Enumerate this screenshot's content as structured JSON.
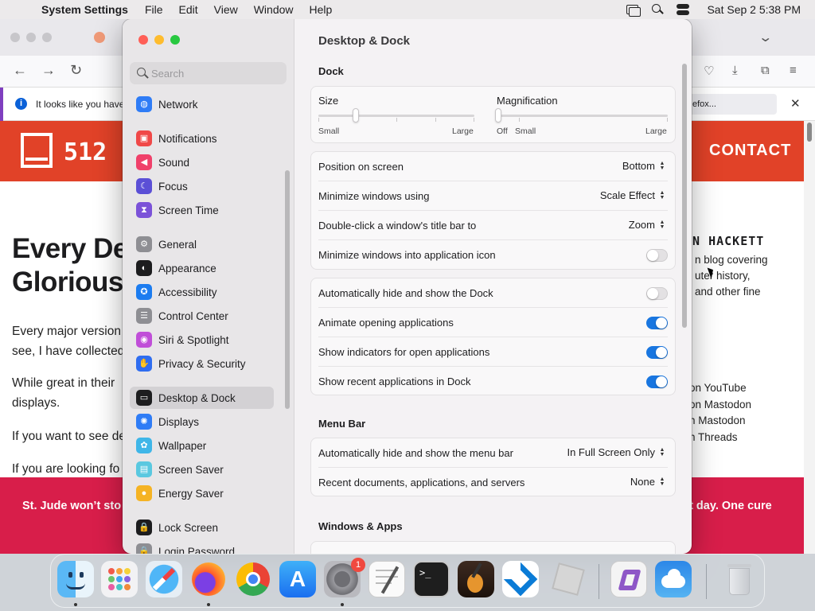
{
  "menubar": {
    "apple_icon": "",
    "app_name": "System Settings",
    "items": [
      "File",
      "Edit",
      "View",
      "Window",
      "Help"
    ],
    "clock": "Sat Sep 2  5:38 PM"
  },
  "browser": {
    "notice": "It looks like you haver",
    "notice_button": "efox...",
    "logo_text": "512",
    "nav_contact": "CONTACT",
    "nav_prev": "N",
    "title_line1": "Every De",
    "title_line2": "Glorious",
    "p1_line1": "Every major version",
    "p1_line2": "see, I have collected",
    "p2_line1": "While great in their",
    "p2_line2": "displays.",
    "p3": "If you want to see de",
    "p4": "If you are looking fo",
    "author": "EN HACKETT",
    "bio1": "n blog covering",
    "bio2": "uter history,",
    "bio3": "and other fine",
    "link1": "on YouTube",
    "link2": "on Mastodon",
    "link3": "n Mastodon",
    "link4": "n Threads",
    "banner_left": "St. Jude won’t sto",
    "banner_right": "at day. One cure"
  },
  "settings": {
    "search_placeholder": "Search",
    "sidebar": [
      {
        "label": "Network",
        "icon": "network-icon",
        "color": "#2f7cf6",
        "glyph": "◍"
      },
      {
        "label": "Notifications",
        "icon": "notifications-icon",
        "color": "#f04848",
        "glyph": "▣"
      },
      {
        "label": "Sound",
        "icon": "sound-icon",
        "color": "#f0406a",
        "glyph": "◀"
      },
      {
        "label": "Focus",
        "icon": "focus-icon",
        "color": "#5b4fd6",
        "glyph": "☾"
      },
      {
        "label": "Screen Time",
        "icon": "screen-time-icon",
        "color": "#7b52d8",
        "glyph": "⧗"
      },
      {
        "label": "General",
        "icon": "general-icon",
        "color": "#8e8e93",
        "glyph": "⚙"
      },
      {
        "label": "Appearance",
        "icon": "appearance-icon",
        "color": "#1d1d1f",
        "glyph": "◐"
      },
      {
        "label": "Accessibility",
        "icon": "accessibility-icon",
        "color": "#1c7cf0",
        "glyph": "✪"
      },
      {
        "label": "Control Center",
        "icon": "control-center-icon",
        "color": "#8e8e93",
        "glyph": "☰"
      },
      {
        "label": "Siri & Spotlight",
        "icon": "siri-icon",
        "color": "#c04ed8",
        "glyph": "◉"
      },
      {
        "label": "Privacy & Security",
        "icon": "privacy-icon",
        "color": "#2f6df0",
        "glyph": "✋"
      },
      {
        "label": "Desktop & Dock",
        "icon": "desktop-dock-icon",
        "color": "#1d1d1f",
        "glyph": "▭"
      },
      {
        "label": "Displays",
        "icon": "displays-icon",
        "color": "#2f7cf6",
        "glyph": "✺"
      },
      {
        "label": "Wallpaper",
        "icon": "wallpaper-icon",
        "color": "#3fb6e8",
        "glyph": "✿"
      },
      {
        "label": "Screen Saver",
        "icon": "screen-saver-icon",
        "color": "#5ac8e0",
        "glyph": "▤"
      },
      {
        "label": "Energy Saver",
        "icon": "energy-saver-icon",
        "color": "#f5b324",
        "glyph": "●"
      },
      {
        "label": "Lock Screen",
        "icon": "lock-screen-icon",
        "color": "#1d1d1f",
        "glyph": "🔒"
      },
      {
        "label": "Login Password",
        "icon": "login-password-icon",
        "color": "#8e8e93",
        "glyph": "🔒"
      }
    ],
    "selected_index": 11,
    "title": "Desktop & Dock",
    "dock_section": "Dock",
    "size_label": "Size",
    "size_small": "Small",
    "size_large": "Large",
    "size_value": 0.24,
    "mag_label": "Magnification",
    "mag_off": "Off",
    "mag_small": "Small",
    "mag_large": "Large",
    "mag_value": 0.0,
    "position_label": "Position on screen",
    "position_value": "Bottom",
    "minimize_label": "Minimize windows using",
    "minimize_value": "Scale Effect",
    "doubleclick_label": "Double-click a window's title bar to",
    "doubleclick_value": "Zoom",
    "minimize_app_label": "Minimize windows into application icon",
    "autohide_label": "Automatically hide and show the Dock",
    "animate_label": "Animate opening applications",
    "indicators_label": "Show indicators for open applications",
    "recent_label": "Show recent applications in Dock",
    "menubar_section": "Menu Bar",
    "menubar_autohide_label": "Automatically hide and show the menu bar",
    "menubar_autohide_value": "In Full Screen Only",
    "recent_docs_label": "Recent documents, applications, and servers",
    "recent_docs_value": "None",
    "windows_section": "Windows & Apps",
    "colors": {
      "accent": "#1976e0",
      "close": "#ff5f57",
      "minimize": "#febc2e",
      "zoom": "#28c840"
    }
  },
  "dock": {
    "apps": [
      "Finder",
      "Launchpad",
      "Safari",
      "Firefox",
      "Chrome",
      "App Store",
      "System Settings",
      "TextEdit",
      "Terminal",
      "GarageBand",
      "Visual Studio Code",
      "Roblox",
      "Visual Studio",
      "Weather",
      "Trash"
    ],
    "settings_badge": "1"
  }
}
